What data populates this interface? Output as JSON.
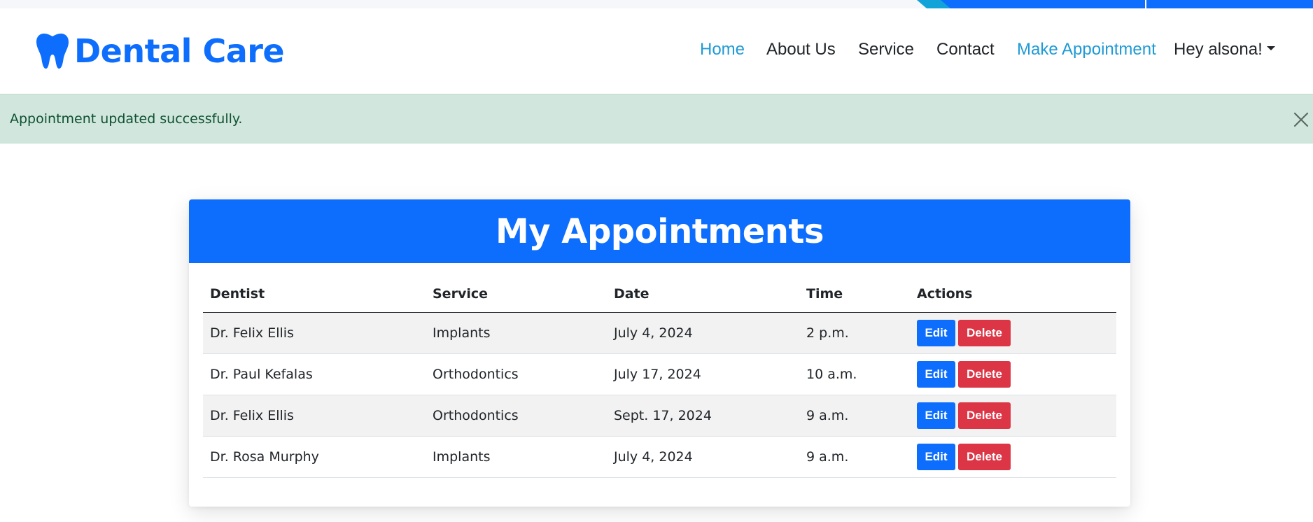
{
  "brand": {
    "name": "Dental Care",
    "icon": "tooth-icon",
    "color": "#0d6efd"
  },
  "nav": {
    "items": [
      {
        "label": "Home",
        "active": true
      },
      {
        "label": "About Us",
        "active": false
      },
      {
        "label": "Service",
        "active": false
      },
      {
        "label": "Contact",
        "active": false
      },
      {
        "label": "Make Appointment",
        "active": true
      }
    ],
    "user_menu": "Hey alsona!"
  },
  "alert": {
    "message": "Appointment updated successfully.",
    "close_icon": "close-icon",
    "color": "#d1e7dd"
  },
  "appointments": {
    "title": "My Appointments",
    "columns": [
      "Dentist",
      "Service",
      "Date",
      "Time",
      "Actions"
    ],
    "rows": [
      {
        "dentist": "Dr. Felix Ellis",
        "service": "Implants",
        "date": "July 4, 2024",
        "time": "2 p.m."
      },
      {
        "dentist": "Dr. Paul Kefalas",
        "service": "Orthodontics",
        "date": "July 17, 2024",
        "time": "10 a.m."
      },
      {
        "dentist": "Dr. Felix Ellis",
        "service": "Orthodontics",
        "date": "Sept. 17, 2024",
        "time": "9 a.m."
      },
      {
        "dentist": "Dr. Rosa Murphy",
        "service": "Implants",
        "date": "July 4, 2024",
        "time": "9 a.m."
      }
    ],
    "edit_label": "Edit",
    "delete_label": "Delete",
    "edit_color": "#0d6efd",
    "delete_color": "#dc3545"
  }
}
